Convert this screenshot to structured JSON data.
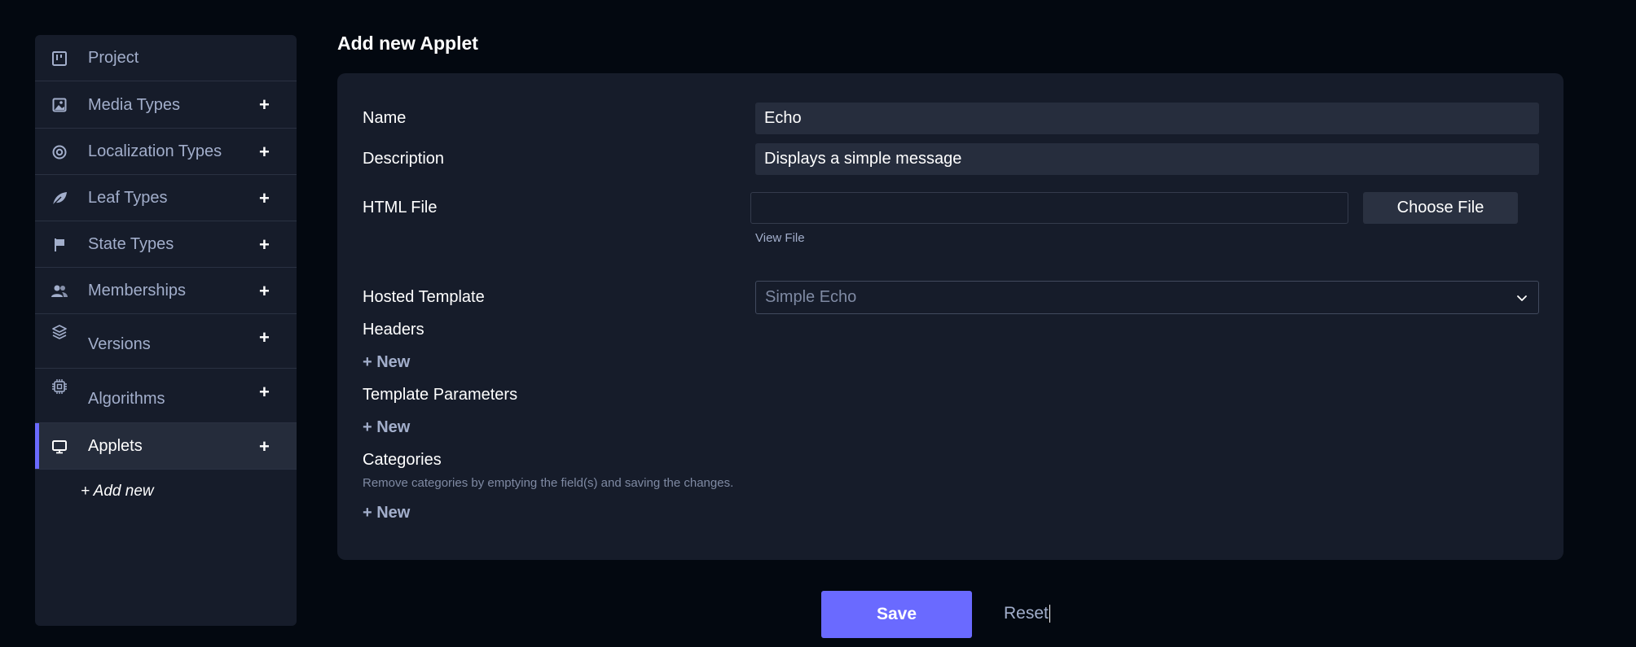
{
  "sidebar": {
    "items": [
      {
        "label": "Project",
        "icon": "board-icon",
        "has_add": false
      },
      {
        "label": "Media Types",
        "icon": "image-icon",
        "has_add": true
      },
      {
        "label": "Localization Types",
        "icon": "target-icon",
        "has_add": true
      },
      {
        "label": "Leaf Types",
        "icon": "leaf-icon",
        "has_add": true
      },
      {
        "label": "State Types",
        "icon": "flag-icon",
        "has_add": true
      },
      {
        "label": "Memberships",
        "icon": "users-icon",
        "has_add": true
      },
      {
        "label": "Versions",
        "icon": "layers-icon",
        "has_add": true
      },
      {
        "label": "Algorithms",
        "icon": "cpu-icon",
        "has_add": true
      },
      {
        "label": "Applets",
        "icon": "monitor-icon",
        "has_add": true,
        "active": true
      }
    ],
    "plus": "+",
    "add_new": "+ Add new"
  },
  "page": {
    "title": "Add new Applet"
  },
  "form": {
    "name_label": "Name",
    "name_value": "Echo",
    "description_label": "Description",
    "description_value": "Displays a simple message",
    "html_file_label": "HTML File",
    "choose_file": "Choose File",
    "view_file": "View File",
    "hosted_template_label": "Hosted Template",
    "hosted_template_value": "Simple Echo",
    "headers_label": "Headers",
    "headers_new": "+ New",
    "template_params_label": "Template Parameters",
    "template_params_new": "+ New",
    "categories_label": "Categories",
    "categories_hint": "Remove categories by emptying the field(s) and saving the changes.",
    "categories_new": "+ New"
  },
  "actions": {
    "save": "Save",
    "reset": "Reset"
  },
  "colors": {
    "accent": "#6a6aff",
    "background": "#030810",
    "card": "#161c2a",
    "muted_text": "#a2aecb"
  }
}
